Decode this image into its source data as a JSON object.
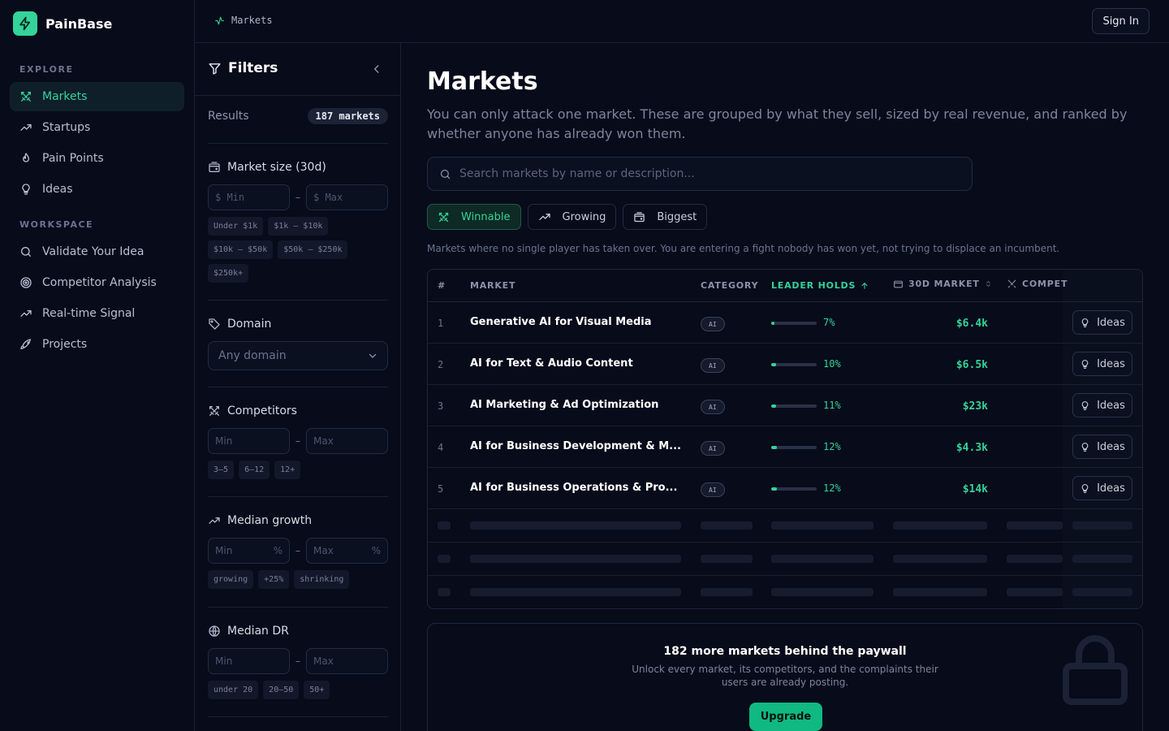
{
  "app": {
    "name": "PainBase"
  },
  "sidebar": {
    "explore_label": "EXPLORE",
    "explore_items": [
      {
        "label": "Markets",
        "icon": "swords-icon",
        "active": true
      },
      {
        "label": "Startups",
        "icon": "trending-up-icon"
      },
      {
        "label": "Pain Points",
        "icon": "flame-icon"
      },
      {
        "label": "Ideas",
        "icon": "lightbulb-icon"
      }
    ],
    "workspace_label": "WORKSPACE",
    "workspace_items": [
      {
        "label": "Validate Your Idea",
        "icon": "search-icon"
      },
      {
        "label": "Competitor Analysis",
        "icon": "target-icon"
      },
      {
        "label": "Real-time Signal",
        "icon": "trending-up-icon"
      },
      {
        "label": "Projects",
        "icon": "rocket-icon"
      }
    ]
  },
  "topbar": {
    "breadcrumb": "Markets",
    "signin_label": "Sign In"
  },
  "filters": {
    "title": "Filters",
    "results_label": "Results",
    "results_count": "187 markets",
    "market_size": {
      "label": "Market size (30d)",
      "min_placeholder": "$ Min",
      "max_placeholder": "$ Max",
      "chips": [
        "Under $1k",
        "$1k – $10k",
        "$10k – $50k",
        "$50k – $250k",
        "$250k+"
      ]
    },
    "domain": {
      "label": "Domain",
      "placeholder": "Any domain"
    },
    "competitors": {
      "label": "Competitors",
      "min_placeholder": "Min",
      "max_placeholder": "Max",
      "chips": [
        "3–5",
        "6–12",
        "12+"
      ]
    },
    "median_growth": {
      "label": "Median growth",
      "min_placeholder": "Min",
      "max_placeholder": "Max",
      "unit": "%",
      "chips": [
        "growing",
        "+25%",
        "shrinking"
      ]
    },
    "median_dr": {
      "label": "Median DR",
      "min_placeholder": "Min",
      "max_placeholder": "Max",
      "chips": [
        "under 20",
        "20–50",
        "50+"
      ]
    },
    "range_separator": "–"
  },
  "main": {
    "title": "Markets",
    "subtitle": "You can only attack one market. These are grouped by what they sell, sized by real revenue, and ranked by whether anyone has already won them.",
    "search_placeholder": "Search markets by name or description...",
    "tabs": [
      {
        "label": "Winnable",
        "icon": "swords-icon",
        "active": true
      },
      {
        "label": "Growing",
        "icon": "trending-up-icon"
      },
      {
        "label": "Biggest",
        "icon": "wallet-icon"
      }
    ],
    "tab_description": "Markets where no single player has taken over. You are entering a fight nobody has won yet, not trying to displace an incumbent.",
    "table": {
      "headers": {
        "num": "#",
        "market": "MARKET",
        "category": "CATEGORY",
        "leader": "LEADER HOLDS",
        "market30": "30D MARKET",
        "competitors": "COMPET"
      },
      "rows": [
        {
          "num": "1",
          "name": "Generative AI for Visual Media",
          "category": "AI",
          "leader": "7%",
          "leader_value": 0.07,
          "revenue": "$6.4k"
        },
        {
          "num": "2",
          "name": "AI for Text & Audio Content",
          "category": "AI",
          "leader": "10%",
          "leader_value": 0.1,
          "revenue": "$6.5k"
        },
        {
          "num": "3",
          "name": "AI Marketing & Ad Optimization",
          "category": "AI",
          "leader": "11%",
          "leader_value": 0.11,
          "revenue": "$23k"
        },
        {
          "num": "4",
          "name": "AI for Business Development & M...",
          "category": "AI",
          "leader": "12%",
          "leader_value": 0.12,
          "revenue": "$4.3k"
        },
        {
          "num": "5",
          "name": "AI for Business Operations & Pro...",
          "category": "AI",
          "leader": "12%",
          "leader_value": 0.12,
          "revenue": "$14k"
        }
      ],
      "ideas_label": "Ideas"
    },
    "paywall": {
      "title": "182 more markets behind the paywall",
      "text": "Unlock every market, its competitors, and the complaints their users are already posting.",
      "button": "Upgrade"
    }
  },
  "colors": {
    "accent": "#34d399",
    "background": "#070b1a",
    "border": "#1b2236"
  }
}
